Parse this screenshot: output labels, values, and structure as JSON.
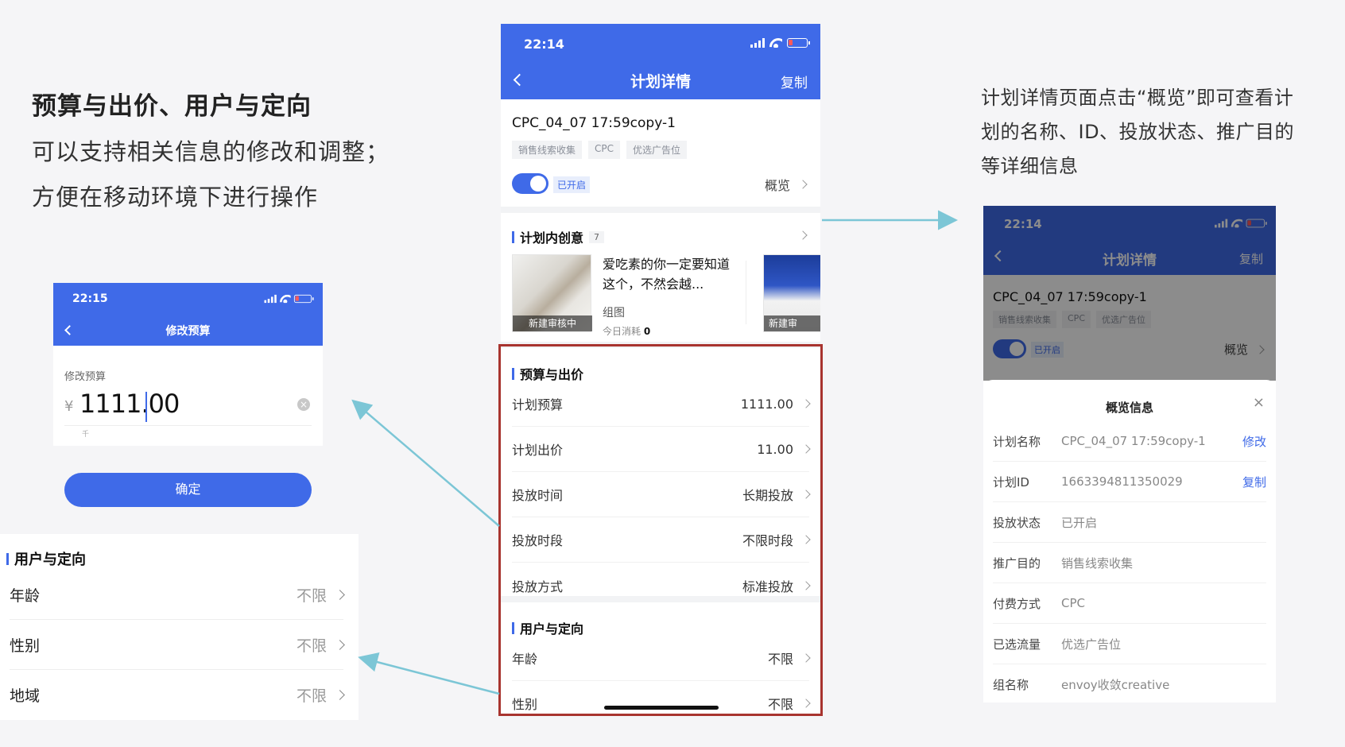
{
  "left_text": {
    "title": "预算与出价、用户与定向",
    "line1": "可以支持相关信息的修改和调整；",
    "line2": "方便在移动环境下进行操作"
  },
  "right_text": {
    "line1": "计划详情页面点击“概览”即可查看计",
    "line2": "划的名称、ID、投放状态、推广目的",
    "line3": "等详细信息"
  },
  "center_phone": {
    "status_time": "22:14",
    "nav_title": "计划详情",
    "nav_action": "复制",
    "plan_name": "CPC_04_07 17:59copy-1",
    "tags": [
      "销售线索收集",
      "CPC",
      "优选广告位"
    ],
    "status_badge": "已开启",
    "overview_label": "概览",
    "creative_section": {
      "title": "计划内创意",
      "count": "7",
      "item_title": "爱吃素的你一定要知道这个，不然会越...",
      "item_type": "组图",
      "cost_label": "今日消耗",
      "cost_value": "0",
      "review_label": "新建审核中",
      "review_label_2": "新建审"
    },
    "budget_section": {
      "title": "预算与出价",
      "rows": [
        {
          "label": "计划预算",
          "value": "1111.00"
        },
        {
          "label": "计划出价",
          "value": "11.00"
        },
        {
          "label": "投放时间",
          "value": "长期投放"
        },
        {
          "label": "投放时段",
          "value": "不限时段"
        },
        {
          "label": "投放方式",
          "value": "标准投放"
        }
      ]
    },
    "user_section": {
      "title": "用户与定向",
      "rows": [
        {
          "label": "年龄",
          "value": "不限"
        },
        {
          "label": "性别",
          "value": "不限"
        }
      ]
    }
  },
  "left_phone": {
    "status_time": "22:15",
    "nav_title": "修改预算",
    "field_label": "修改预算",
    "currency": "¥",
    "amount": "1111.00",
    "unit_hint": "千",
    "confirm_label": "确定"
  },
  "left_user": {
    "title": "用户与定向",
    "rows": [
      {
        "label": "年龄",
        "value": "不限"
      },
      {
        "label": "性别",
        "value": "不限"
      },
      {
        "label": "地域",
        "value": "不限"
      }
    ]
  },
  "right_phone": {
    "status_time": "22:14",
    "nav_title": "计划详情",
    "nav_action": "复制",
    "plan_name": "CPC_04_07 17:59copy-1",
    "tags": [
      "销售线索收集",
      "CPC",
      "优选广告位"
    ],
    "status_badge": "已开启",
    "overview_label": "概览",
    "sheet_title": "概览信息",
    "close_icon": "×",
    "rows": [
      {
        "label": "计划名称",
        "value": "CPC_04_07 17:59copy-1",
        "action": "修改"
      },
      {
        "label": "计划ID",
        "value": "1663394811350029",
        "action": "复制"
      },
      {
        "label": "投放状态",
        "value": "已开启",
        "action": ""
      },
      {
        "label": "推广目的",
        "value": "销售线索收集",
        "action": ""
      },
      {
        "label": "付费方式",
        "value": "CPC",
        "action": ""
      },
      {
        "label": "已选流量",
        "value": "优选广告位",
        "action": ""
      },
      {
        "label": "组名称",
        "value": "envoy收敛creative",
        "action": ""
      }
    ]
  },
  "colors": {
    "brand": "#3f6ae8",
    "highlight_frame": "#a8342f",
    "arrow": "#7cc6d6"
  }
}
